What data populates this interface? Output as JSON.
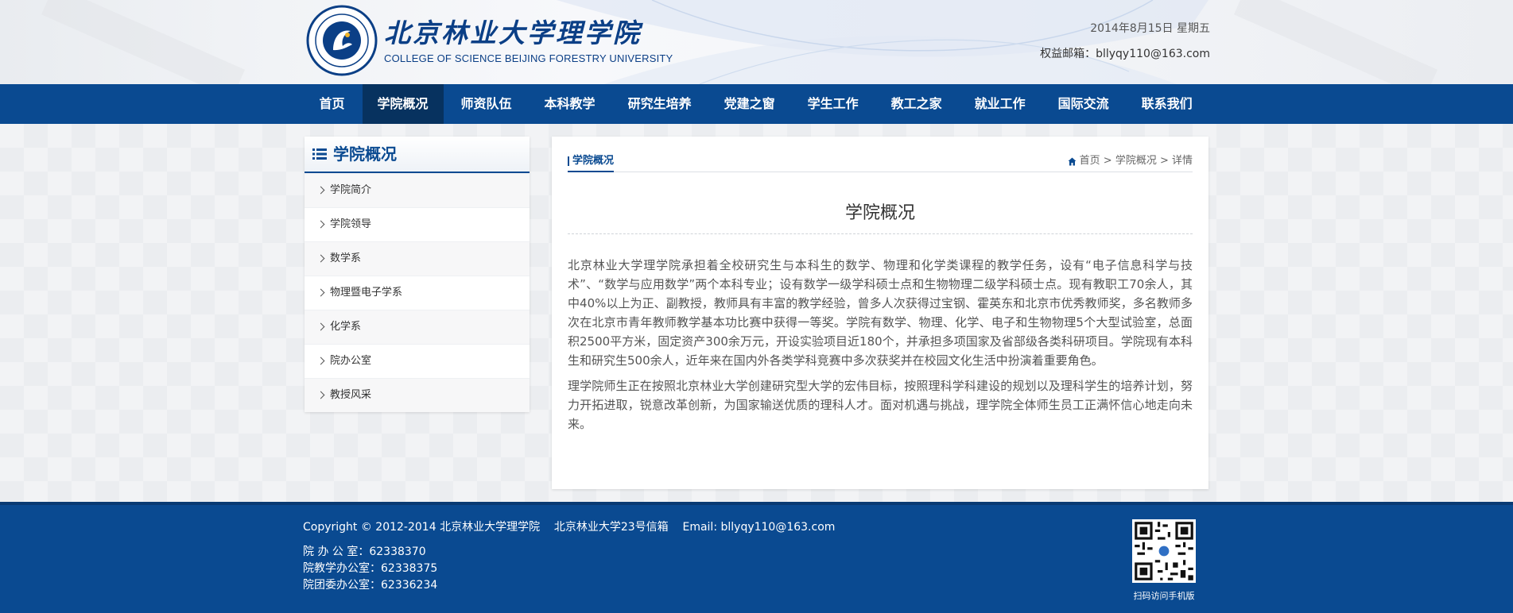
{
  "header": {
    "logo_cn": "北京林业大学理学院",
    "logo_en": "COLLEGE OF SCIENCE BEIJING FORESTRY UNIVERSITY",
    "date": "2014年8月15日 星期五",
    "email_line": "权益邮箱：bllyqy110@163.com"
  },
  "nav": {
    "items": [
      "首页",
      "学院概况",
      "师资队伍",
      "本科教学",
      "研究生培养",
      "党建之窗",
      "学生工作",
      "教工之家",
      "就业工作",
      "国际交流",
      "联系我们"
    ],
    "active_index": 1
  },
  "sidebar": {
    "title": "学院概况",
    "items": [
      "学院简介",
      "学院领导",
      "数学系",
      "物理暨电子学系",
      "化学系",
      "院办公室",
      "教授风采"
    ]
  },
  "main": {
    "tab": "学院概况",
    "breadcrumb": "首页 > 学院概况 > 详情",
    "title": "学院概况",
    "paragraphs": [
      "北京林业大学理学院承担着全校研究生与本科生的数学、物理和化学类课程的教学任务，设有“电子信息科学与技术”、“数学与应用数学”两个本科专业；设有数学一级学科硕士点和生物物理二级学科硕士点。现有教职工70余人，其中40%以上为正、副教授，教师具有丰富的教学经验，曾多人次获得过宝钢、霍英东和北京市优秀教师奖，多名教师多次在北京市青年教师教学基本功比赛中获得一等奖。学院有数学、物理、化学、电子和生物物理5个大型试验室，总面积2500平方米，固定资产300余万元，开设实验项目近180个，并承担多项国家及省部级各类科研项目。学院现有本科生和研究生500余人，近年来在国内外各类学科竞赛中多次获奖并在校园文化生活中扮演着重要角色。",
      "理学院师生正在按照北京林业大学创建研究型大学的宏伟目标，按照理科学科建设的规划以及理科学生的培养计划，努力开拓进取，锐意改革创新，为国家输送优质的理科人才。面对机遇与挑战，理学院全体师生员工正满怀信心地走向未来。"
    ]
  },
  "footer": {
    "copyright": "Copyright © 2012-2014 北京林业大学理学院    北京林业大学23号信箱    Email: bllyqy110@163.com",
    "phones": [
      "院 办 公 室：62338370",
      "院教学办公室：62338375",
      "院团委办公室：62336234"
    ],
    "qr_caption": "扫码访问手机版"
  },
  "colors": {
    "primary": "#0a4a91",
    "nav_active": "#07325f"
  }
}
